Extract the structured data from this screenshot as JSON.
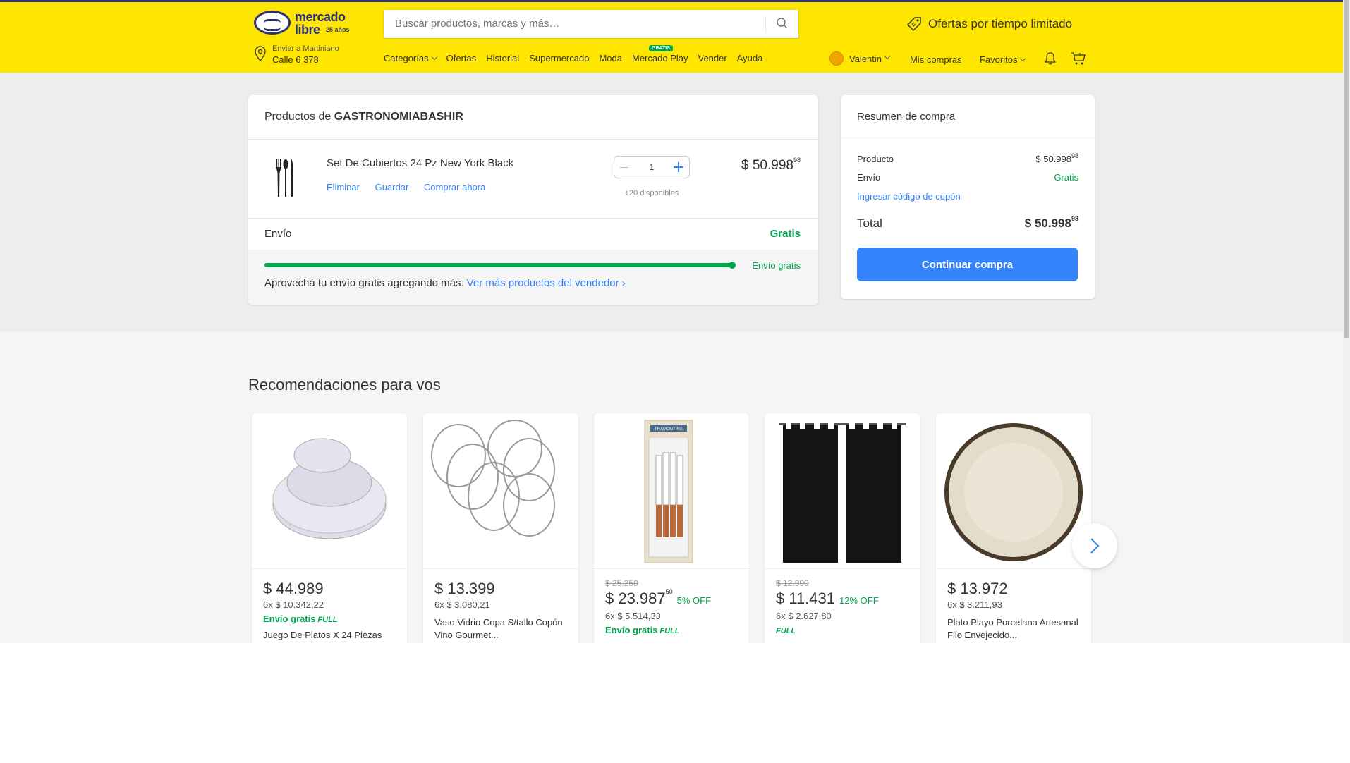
{
  "header": {
    "logo_line1": "mercado",
    "logo_line2": "libre",
    "logo_badge": "25 años",
    "search_placeholder": "Buscar productos, marcas y más…",
    "promo": "Ofertas por tiempo limitado",
    "location_label": "Enviar a Martiniano",
    "location_address": "Calle 6 378",
    "nav": [
      {
        "label": "Categorías"
      },
      {
        "label": "Ofertas"
      },
      {
        "label": "Historial"
      },
      {
        "label": "Supermercado"
      },
      {
        "label": "Moda"
      },
      {
        "label": "Mercado Play",
        "badge": "GRATIS"
      },
      {
        "label": "Vender"
      },
      {
        "label": "Ayuda"
      }
    ],
    "user_name": "Valentin",
    "my_purchases": "Mis compras",
    "favorites": "Favoritos"
  },
  "cart": {
    "title_prefix": "Productos de",
    "seller": "GASTRONOMIABASHIR",
    "item": {
      "name": "Set De Cubiertos 24 Pz New York Black",
      "actions": [
        "Eliminar",
        "Guardar",
        "Comprar ahora"
      ],
      "quantity": "1",
      "available": "+20 disponibles",
      "price": "$ 50.998",
      "price_cents": "98"
    },
    "shipping_label": "Envío",
    "shipping_value": "Gratis",
    "free_shipping_progress": 1.0,
    "free_shipping_label": "Envío gratis",
    "free_shipping_text": "Aprovechá tu envío gratis agregando más.",
    "free_shipping_link": "Ver más productos del vendedor ›"
  },
  "summary": {
    "title": "Resumen de compra",
    "product_label": "Producto",
    "product_value": "$ 50.998",
    "product_cents": "98",
    "shipping_label": "Envío",
    "shipping_value": "Gratis",
    "coupon_link": "Ingresar código de cupón",
    "total_label": "Total",
    "total_value": "$ 50.998",
    "total_cents": "98",
    "continue_button": "Continuar compra"
  },
  "recommendations": {
    "title": "Recomendaciones para vos",
    "items": [
      {
        "price": "$ 44.989",
        "installments": "6x $ 10.342,22",
        "shipping": "Envío gratis",
        "full": "FULL",
        "name": "Juego De Platos X 24 Piezas"
      },
      {
        "price": "$ 13.399",
        "installments": "6x $ 3.080,21",
        "name": "Vaso Vidrio Copa S/tallo Copón Vino Gourmet..."
      },
      {
        "old_price": "$ 25.250",
        "price": "$ 23.987",
        "cents": "50",
        "discount": "5% OFF",
        "installments": "6x $ 5.514,33",
        "shipping": "Envío gratis",
        "full": "FULL",
        "brand": "TRAMONTINA"
      },
      {
        "old_price": "$ 12.990",
        "price": "$ 11.431",
        "discount": "12% OFF",
        "installments": "6x $ 2.627,80",
        "full": "FULL"
      },
      {
        "price": "$ 13.972",
        "installments": "6x $ 3.211,93",
        "name": "Plato Playo Porcelana Artesanal Filo Envejecido..."
      }
    ]
  },
  "colors": {
    "header_bg": "#fee600",
    "brand_blue": "#3483fa",
    "green": "#00a650"
  }
}
